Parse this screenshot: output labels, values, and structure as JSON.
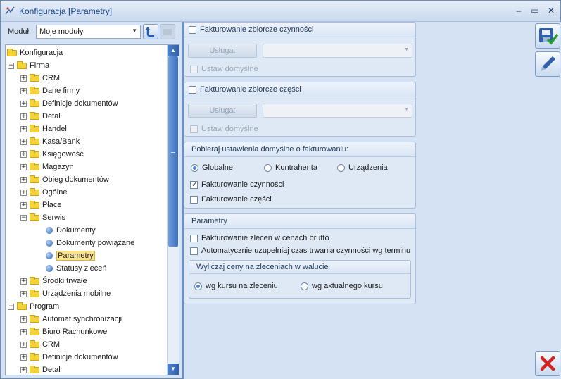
{
  "window": {
    "title": "Konfiguracja [Parametry]",
    "controls": {
      "minimize": "–",
      "maximize": "▭",
      "close": "✕"
    }
  },
  "modul": {
    "label": "Moduł:",
    "value": "Moje moduły"
  },
  "tree": {
    "items": [
      {
        "label": "Konfiguracja",
        "level": 0,
        "kind": "root"
      },
      {
        "label": "Firma",
        "level": 1,
        "kind": "open"
      },
      {
        "label": "CRM",
        "level": 2,
        "kind": "closed"
      },
      {
        "label": "Dane firmy",
        "level": 2,
        "kind": "closed"
      },
      {
        "label": "Definicje dokumentów",
        "level": 2,
        "kind": "closed"
      },
      {
        "label": "Detal",
        "level": 2,
        "kind": "closed"
      },
      {
        "label": "Handel",
        "level": 2,
        "kind": "closed"
      },
      {
        "label": "Kasa/Bank",
        "level": 2,
        "kind": "closed"
      },
      {
        "label": "Księgowość",
        "level": 2,
        "kind": "closed"
      },
      {
        "label": "Magazyn",
        "level": 2,
        "kind": "closed"
      },
      {
        "label": "Obieg dokumentów",
        "level": 2,
        "kind": "closed"
      },
      {
        "label": "Ogólne",
        "level": 2,
        "kind": "closed"
      },
      {
        "label": "Płace",
        "level": 2,
        "kind": "closed"
      },
      {
        "label": "Serwis",
        "level": 2,
        "kind": "open"
      },
      {
        "label": "Dokumenty",
        "level": 3,
        "kind": "leaf"
      },
      {
        "label": "Dokumenty powiązane",
        "level": 3,
        "kind": "leaf"
      },
      {
        "label": "Parametry",
        "level": 3,
        "kind": "leaf",
        "selected": true
      },
      {
        "label": "Statusy zleceń",
        "level": 3,
        "kind": "leaf"
      },
      {
        "label": "Środki trwałe",
        "level": 2,
        "kind": "closed"
      },
      {
        "label": "Urządzenia mobilne",
        "level": 2,
        "kind": "closed"
      },
      {
        "label": "Program",
        "level": 1,
        "kind": "open"
      },
      {
        "label": "Automat synchronizacji",
        "level": 2,
        "kind": "closed"
      },
      {
        "label": "Biuro Rachunkowe",
        "level": 2,
        "kind": "closed"
      },
      {
        "label": "CRM",
        "level": 2,
        "kind": "closed"
      },
      {
        "label": "Definicje dokumentów",
        "level": 2,
        "kind": "closed"
      },
      {
        "label": "Detal",
        "level": 2,
        "kind": "closed"
      }
    ]
  },
  "panel": {
    "group1": {
      "title": "Fakturowanie zbiorcze czynności",
      "service_button": "Usługa:",
      "default_label": "Ustaw domyślne"
    },
    "group2": {
      "title": "Fakturowanie zbiorcze części",
      "service_button": "Usługa:",
      "default_label": "Ustaw domyślne"
    },
    "group3": {
      "title": "Pobieraj ustawienia domyślne o fakturowaniu:",
      "radios": [
        "Globalne",
        "Kontrahenta",
        "Urządzenia"
      ],
      "checks": [
        "Fakturowanie czynności",
        "Fakturowanie części"
      ]
    },
    "group4": {
      "title": "Parametry",
      "checks": [
        "Fakturowanie zleceń w cenach brutto",
        "Automatycznie uzupełniaj czas trwania czynności wg terminu"
      ],
      "subgroup": {
        "title": "Wyliczaj ceny na zleceniach w walucie",
        "radios": [
          "wg kursu na zleceniu",
          "wg aktualnego kursu"
        ]
      }
    }
  },
  "side_buttons": [
    "save-icon",
    "edit-icon",
    "cancel-icon"
  ]
}
